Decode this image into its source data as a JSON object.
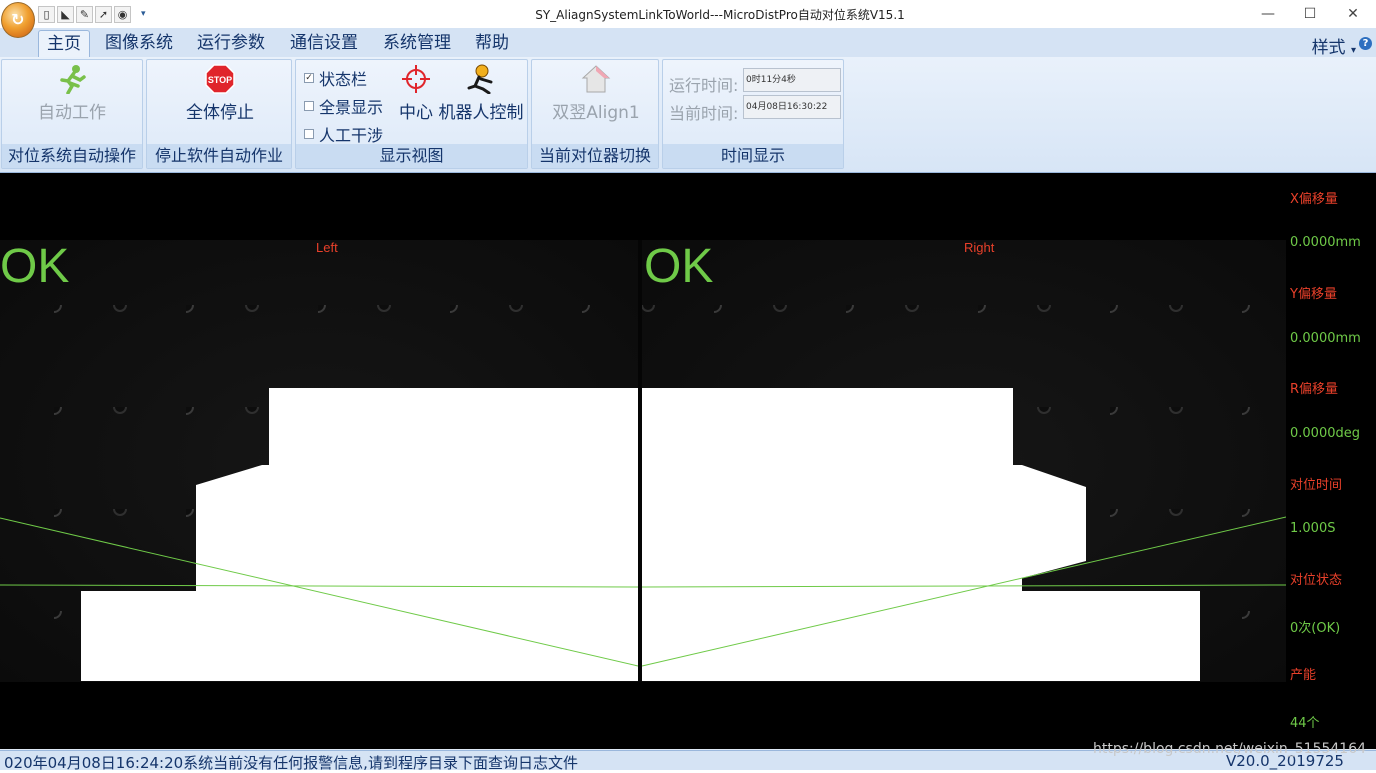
{
  "window": {
    "title": "SY_AliagnSystemLinkToWorld---MicroDistPro自动对位系统V15.1",
    "minimize": "—",
    "maximize": "☐",
    "close": "✕"
  },
  "quick_access": {
    "dropdown": "▾"
  },
  "tabs": [
    {
      "label": "主页"
    },
    {
      "label": "图像系统"
    },
    {
      "label": "运行参数"
    },
    {
      "label": "通信设置"
    },
    {
      "label": "系统管理"
    },
    {
      "label": "帮助"
    }
  ],
  "style_menu": "样式",
  "style_menu_arrow": "▾",
  "help_icon": "?",
  "ribbon": {
    "auto": {
      "button": "自动工作",
      "group": "对位系统自动操作"
    },
    "stop": {
      "button": "全体停止",
      "icon_text": "STOP",
      "group": "停止软件自动作业"
    },
    "display": {
      "checkboxes": [
        {
          "label": "状态栏",
          "checked": true
        },
        {
          "label": "全景显示",
          "checked": false
        },
        {
          "label": "人工干涉",
          "checked": false
        }
      ],
      "center_button": "中心",
      "robot_button": "机器人控制",
      "group": "显示视图"
    },
    "switch": {
      "button": "双翌Align1",
      "group": "当前对位器切换"
    },
    "time": {
      "run_label": "运行时间:",
      "run_value": "0时11分4秒",
      "current_label": "当前时间:",
      "current_value": "04月08日16:30:22",
      "group": "时间显示"
    }
  },
  "cameras": {
    "left": {
      "label": "Left",
      "status": "OK"
    },
    "right": {
      "label": "Right",
      "status": "OK"
    }
  },
  "side_panel": [
    {
      "label": "X偏移量",
      "value": "0.0000mm"
    },
    {
      "label": "Y偏移量",
      "value": "0.0000mm"
    },
    {
      "label": "R偏移量",
      "value": "0.0000deg"
    },
    {
      "label": "对位时间",
      "value": "1.000S"
    },
    {
      "label": "对位状态",
      "value": "0次(OK)"
    },
    {
      "label": "产能",
      "value": "44个"
    }
  ],
  "status": {
    "message": "020年04月08日16:24:20系统当前没有任何报警信息,请到程序目录下面查询日志文件",
    "version": "V20.0_2019725"
  },
  "watermark": "https://blog.csdn.net/weixin_51554164",
  "colors": {
    "ok": "#6fca48",
    "label_red": "#e8402a",
    "guide_line": "#6fca48",
    "ribbon_text": "#15356b"
  }
}
